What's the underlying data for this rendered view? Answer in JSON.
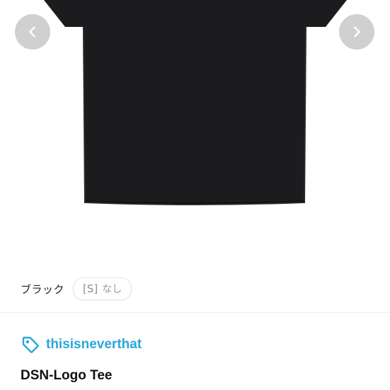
{
  "carousel": {
    "image_alt": "black t-shirt",
    "prev_icon": "chevron-left-icon",
    "next_icon": "chevron-right-icon"
  },
  "options": {
    "color": "ブラック",
    "size": "[S]",
    "stock": "なし"
  },
  "brand": {
    "icon": "tag-icon",
    "name": "thisisneverthat",
    "color": "#2aa6d9"
  },
  "product": {
    "title": "DSN-Logo Tee"
  }
}
